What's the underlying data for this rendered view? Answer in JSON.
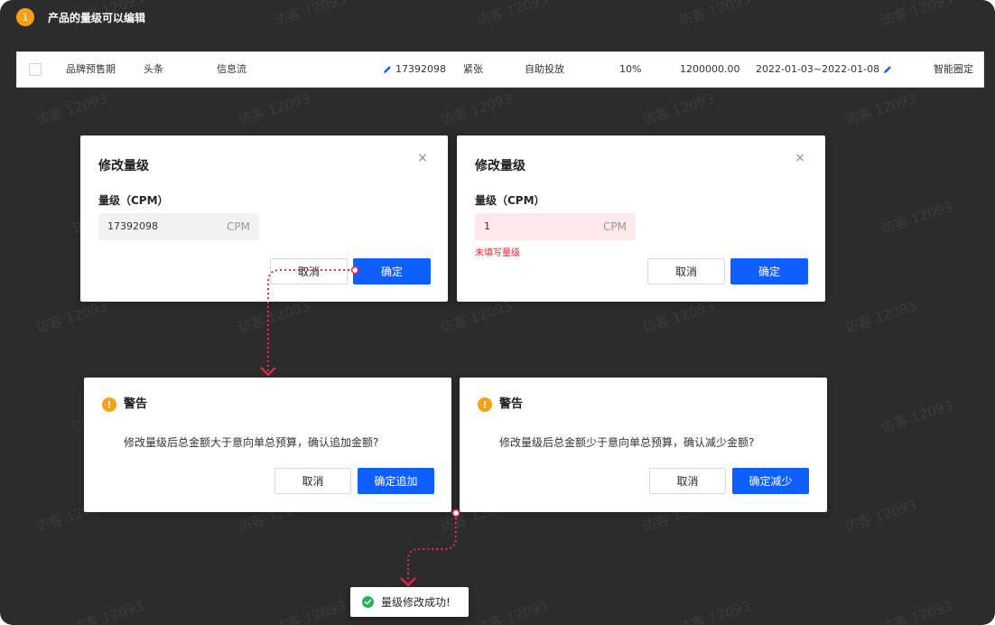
{
  "watermark": "访客 12093",
  "step": {
    "number": "1",
    "title": "产品的量级可以编辑"
  },
  "table_row": {
    "col_product": "品牌预售期",
    "col_media": "头条",
    "col_type": "信息流",
    "col_cpm": "17392098",
    "col_status": "紧张",
    "col_mode": "自助投放",
    "col_ratio": "10%",
    "col_amount": "1200000.00",
    "col_dates": "2022-01-03~2022-01-08",
    "col_strategy": "智能圈定"
  },
  "edit_dialog_ok": {
    "title": "修改量级",
    "close": "×",
    "label": "量级（CPM）",
    "value": "17392098",
    "unit": "CPM",
    "cancel": "取消",
    "confirm": "确定"
  },
  "edit_dialog_error": {
    "title": "修改量级",
    "close": "×",
    "label": "量级（CPM）",
    "value": "1",
    "unit": "CPM",
    "error": "未填写量级",
    "cancel": "取消",
    "confirm": "确定"
  },
  "warn_increase": {
    "icon": "!",
    "title": "警告",
    "message": "修改量级后总金额大于意向单总预算，确认追加金额?",
    "cancel": "取消",
    "confirm": "确定追加"
  },
  "warn_decrease": {
    "icon": "!",
    "title": "警告",
    "message": "修改量级后总金额少于意向单总预算，确认减少金额?",
    "cancel": "取消",
    "confirm": "确定减少"
  },
  "toast": {
    "message": "量级修改成功!"
  },
  "colors": {
    "background": "#2c2c2d",
    "primary": "#0f5fff",
    "warning": "#fa9f10",
    "error": "#f5222d",
    "success": "#27b35a",
    "flow_line": "#f0284a"
  },
  "icons": [
    "pencil-icon",
    "close-icon",
    "warning-icon",
    "success-check-icon",
    "checkbox"
  ]
}
